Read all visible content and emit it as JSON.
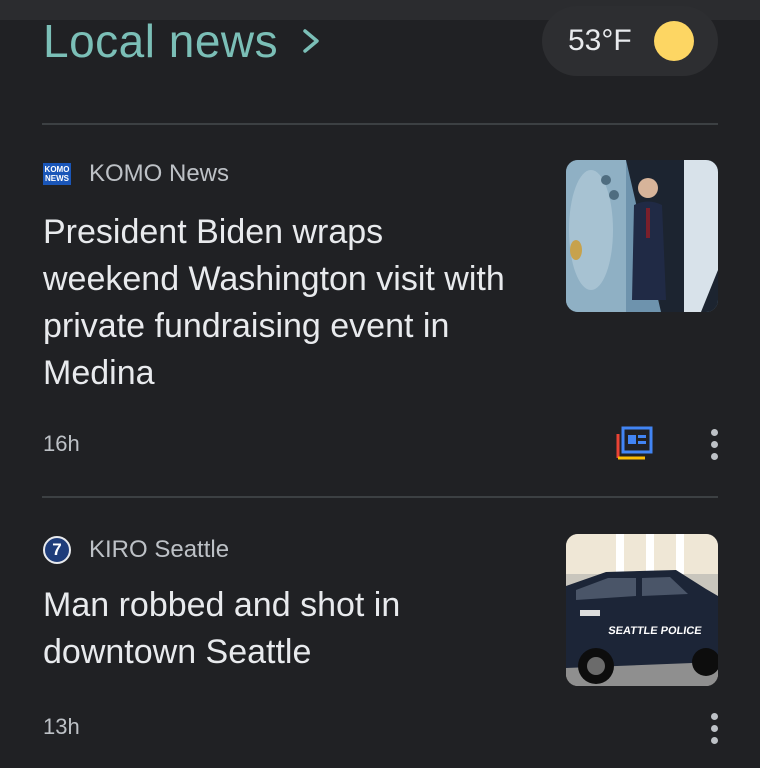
{
  "header": {
    "title": "Local news",
    "chevron_icon": "chevron-right-icon",
    "weather": {
      "temp": "53°F",
      "icon": "sun-icon",
      "icon_color": "#fdd663"
    }
  },
  "articles": [
    {
      "source": "KOMO News",
      "source_logo_text": [
        "KOMO",
        "NEWS"
      ],
      "headline": "President Biden wraps weekend Washington visit with private fundraising event in Medina",
      "time": "16h",
      "has_full_coverage": true
    },
    {
      "source": "KIRO Seattle",
      "source_logo_text": "7",
      "headline": "Man robbed and shot in downtown Seattle",
      "time": "13h",
      "has_full_coverage": false,
      "image_text": "SEATTLE POLICE"
    }
  ],
  "colors": {
    "background": "#202124",
    "accent": "#7bbfb7",
    "text": "#e8eaed",
    "muted": "#bdc1c6"
  }
}
